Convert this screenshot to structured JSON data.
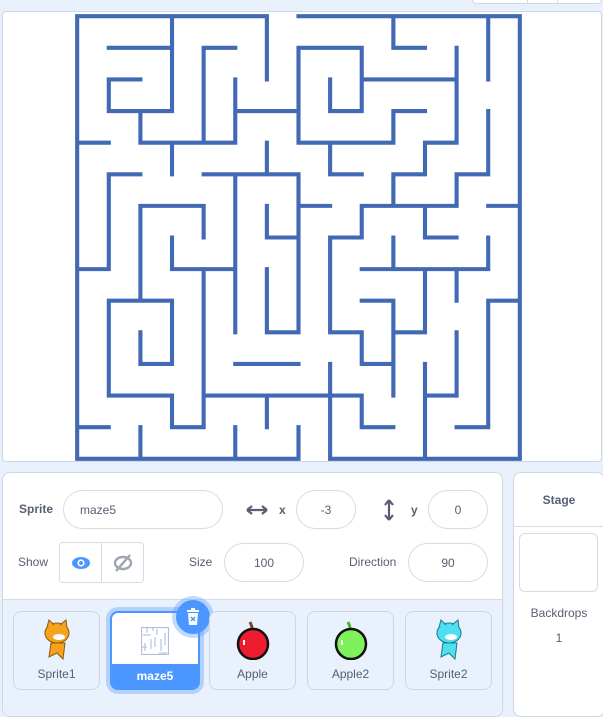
{
  "sprite_info": {
    "sprite_label": "Sprite",
    "sprite_name": "maze5",
    "x_label": "x",
    "x_value": "-3",
    "y_label": "y",
    "y_value": "0",
    "show_label": "Show",
    "size_label": "Size",
    "size_value": "100",
    "direction_label": "Direction",
    "direction_value": "90"
  },
  "sprites": [
    {
      "name": "Sprite1",
      "thumb": "orange-cat"
    },
    {
      "name": "maze5",
      "thumb": "maze",
      "selected": true
    },
    {
      "name": "Apple",
      "thumb": "red-apple"
    },
    {
      "name": "Apple2",
      "thumb": "green-apple"
    },
    {
      "name": "Sprite2",
      "thumb": "cyan-cat"
    }
  ],
  "stage_panel": {
    "title": "Stage",
    "backdrops_label": "Backdrops",
    "backdrops_count": "1"
  },
  "colors": {
    "accent": "#4c97ff",
    "maze_wall": "#4269b4",
    "red_apple": "#ed1c2e",
    "green_apple": "#7df25a"
  }
}
